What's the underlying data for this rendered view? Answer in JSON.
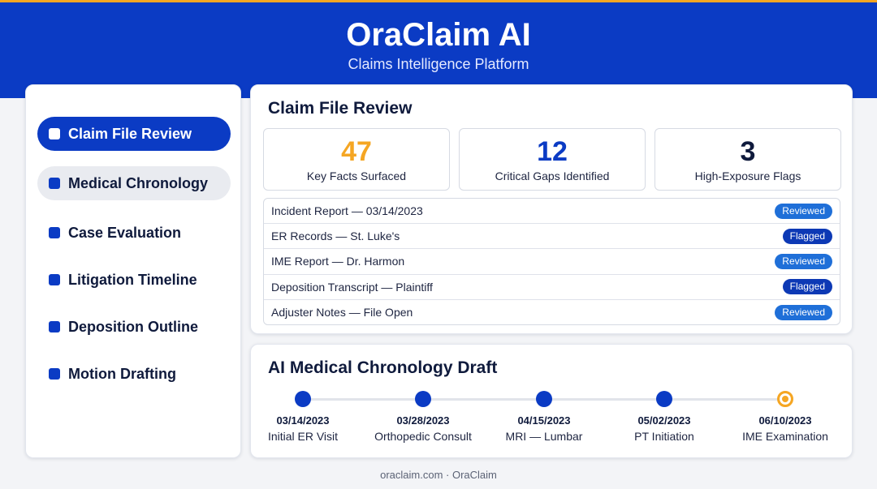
{
  "brand": {
    "title": "OraClaim AI",
    "subtitle": "Claims Intelligence Platform"
  },
  "colors": {
    "primary": "#0b3bc4",
    "accent": "#f5a623",
    "reviewed": "#1f6fd8",
    "flagged": "#0d39b5"
  },
  "sidebar": {
    "items": [
      {
        "label": "Claim File Review",
        "state": "active"
      },
      {
        "label": "Medical Chronology",
        "state": "hover"
      },
      {
        "label": "Case Evaluation",
        "state": "default"
      },
      {
        "label": "Litigation Timeline",
        "state": "default"
      },
      {
        "label": "Deposition Outline",
        "state": "default"
      },
      {
        "label": "Motion Drafting",
        "state": "default"
      }
    ]
  },
  "review": {
    "title": "Claim File Review",
    "stats": [
      {
        "value": "47",
        "label": "Key Facts Surfaced",
        "color": "#f5a623"
      },
      {
        "value": "12",
        "label": "Critical Gaps Identified",
        "color": "#0b3bc4"
      },
      {
        "value": "3",
        "label": "High-Exposure Flags",
        "color": "#0f1a3c"
      }
    ],
    "documents": [
      {
        "name": "Incident Report — 03/14/2023",
        "status": "Reviewed"
      },
      {
        "name": "ER Records — St. Luke's",
        "status": "Flagged"
      },
      {
        "name": "IME Report — Dr. Harmon",
        "status": "Reviewed"
      },
      {
        "name": "Deposition Transcript — Plaintiff",
        "status": "Flagged"
      },
      {
        "name": "Adjuster Notes — File Open",
        "status": "Reviewed"
      }
    ]
  },
  "chronology": {
    "title": "AI Medical Chronology Draft",
    "events": [
      {
        "date": "03/14/2023",
        "label": "Initial ER Visit",
        "state": "done"
      },
      {
        "date": "03/28/2023",
        "label": "Orthopedic Consult",
        "state": "done"
      },
      {
        "date": "04/15/2023",
        "label": "MRI — Lumbar",
        "state": "done"
      },
      {
        "date": "05/02/2023",
        "label": "PT Initiation",
        "state": "done"
      },
      {
        "date": "06/10/2023",
        "label": "IME Examination",
        "state": "pending"
      }
    ]
  },
  "footer": {
    "text": "oraclaim.com · OraClaim"
  }
}
